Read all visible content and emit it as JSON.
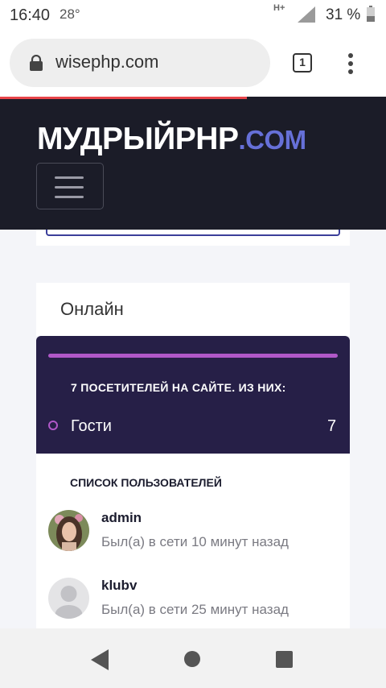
{
  "status_bar": {
    "time": "16:40",
    "temperature": "28°",
    "network": "H+",
    "battery": "31 %"
  },
  "browser": {
    "url": "wisephp.com",
    "tab_count": "1"
  },
  "site": {
    "logo_main": "МУДРЫЙPHP",
    "logo_domain": ".COM"
  },
  "online": {
    "title": "Онлайн",
    "visitors_heading": "7 ПОСЕТИТЕЛЕЙ НА САЙТЕ. ИЗ НИХ:",
    "guests_label": "Гости",
    "guests_count": "7",
    "users_heading": "СПИСОК ПОЛЬЗОВАТЕЛЕЙ",
    "users": [
      {
        "name": "admin",
        "status": "Был(а) в сети 10 минут назад"
      },
      {
        "name": "klubv",
        "status": "Был(а) в сети 25 минут назад"
      }
    ]
  },
  "colors": {
    "header_bg": "#1b1c28",
    "accent_domain": "#6670d8",
    "panel_bg": "#261f47",
    "panel_accent": "#b058c8",
    "progress": "#e8454a"
  }
}
